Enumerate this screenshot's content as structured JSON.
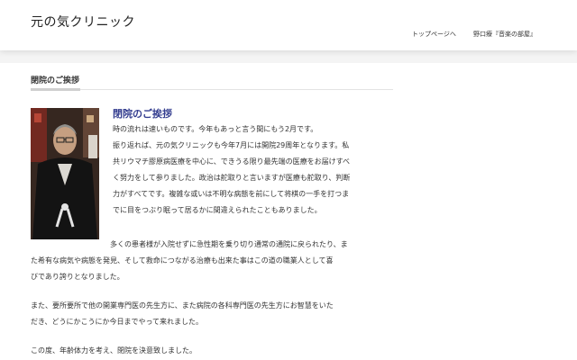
{
  "header": {
    "site_title": "元の気クリニック",
    "nav": {
      "top_page": "トップページへ",
      "music_room": "野口療『音楽の部屋』"
    }
  },
  "main": {
    "section_heading": "閉院のご挨拶",
    "photo_icon": "doctor-portrait-photo",
    "post_title": "閉院のご挨拶",
    "paragraph1": [
      "時の流れは速いものです。今年もあっと言う間にもう2月です。",
      "振り返れば、元の気クリニックも今年7月には開院29周年となります。私",
      "共リウマチ膠原病医療を中心に、できうる限り最先端の医療をお届けすべ",
      "く努力をして参りました。政治は舵取りと言いますが医療も舵取り、判断",
      "力がすべてです。複雑な或いは不明な病態を前にして将棋の一手を打つま",
      "でに目をつぶり眠って居るかに間違えられたこともありました。"
    ],
    "paragraph2": [
      "多くの患者様が入院せずに急性期を乗り切り通常の通院に戻られたり、ま",
      "た希有な病気や病態を発見、そして救命につながる治療も出来た事はこの道の職業人として喜",
      "びであり誇りとなりました。"
    ],
    "paragraph3": [
      "また、要所要所で他の開業専門医の先生方に、また病院の各科専門医の先生方にお智慧をいた",
      "だき、どうにかこうにか今日までやって来れました。"
    ],
    "paragraph4": [
      "この度、年齢体力を考え、閉院を決意致しました。"
    ]
  }
}
